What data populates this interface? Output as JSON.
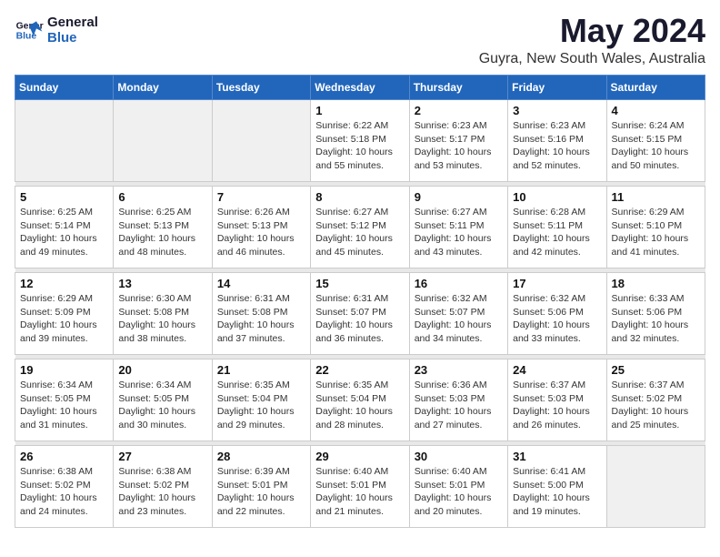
{
  "header": {
    "logo_line1": "General",
    "logo_line2": "Blue",
    "month": "May 2024",
    "location": "Guyra, New South Wales, Australia"
  },
  "weekdays": [
    "Sunday",
    "Monday",
    "Tuesday",
    "Wednesday",
    "Thursday",
    "Friday",
    "Saturday"
  ],
  "weeks": [
    [
      {
        "day": "",
        "empty": true
      },
      {
        "day": "",
        "empty": true
      },
      {
        "day": "",
        "empty": true
      },
      {
        "day": "1",
        "sunrise": "6:22 AM",
        "sunset": "5:18 PM",
        "daylight": "10 hours and 55 minutes."
      },
      {
        "day": "2",
        "sunrise": "6:23 AM",
        "sunset": "5:17 PM",
        "daylight": "10 hours and 53 minutes."
      },
      {
        "day": "3",
        "sunrise": "6:23 AM",
        "sunset": "5:16 PM",
        "daylight": "10 hours and 52 minutes."
      },
      {
        "day": "4",
        "sunrise": "6:24 AM",
        "sunset": "5:15 PM",
        "daylight": "10 hours and 50 minutes."
      }
    ],
    [
      {
        "day": "5",
        "sunrise": "6:25 AM",
        "sunset": "5:14 PM",
        "daylight": "10 hours and 49 minutes."
      },
      {
        "day": "6",
        "sunrise": "6:25 AM",
        "sunset": "5:13 PM",
        "daylight": "10 hours and 48 minutes."
      },
      {
        "day": "7",
        "sunrise": "6:26 AM",
        "sunset": "5:13 PM",
        "daylight": "10 hours and 46 minutes."
      },
      {
        "day": "8",
        "sunrise": "6:27 AM",
        "sunset": "5:12 PM",
        "daylight": "10 hours and 45 minutes."
      },
      {
        "day": "9",
        "sunrise": "6:27 AM",
        "sunset": "5:11 PM",
        "daylight": "10 hours and 43 minutes."
      },
      {
        "day": "10",
        "sunrise": "6:28 AM",
        "sunset": "5:11 PM",
        "daylight": "10 hours and 42 minutes."
      },
      {
        "day": "11",
        "sunrise": "6:29 AM",
        "sunset": "5:10 PM",
        "daylight": "10 hours and 41 minutes."
      }
    ],
    [
      {
        "day": "12",
        "sunrise": "6:29 AM",
        "sunset": "5:09 PM",
        "daylight": "10 hours and 39 minutes."
      },
      {
        "day": "13",
        "sunrise": "6:30 AM",
        "sunset": "5:08 PM",
        "daylight": "10 hours and 38 minutes."
      },
      {
        "day": "14",
        "sunrise": "6:31 AM",
        "sunset": "5:08 PM",
        "daylight": "10 hours and 37 minutes."
      },
      {
        "day": "15",
        "sunrise": "6:31 AM",
        "sunset": "5:07 PM",
        "daylight": "10 hours and 36 minutes."
      },
      {
        "day": "16",
        "sunrise": "6:32 AM",
        "sunset": "5:07 PM",
        "daylight": "10 hours and 34 minutes."
      },
      {
        "day": "17",
        "sunrise": "6:32 AM",
        "sunset": "5:06 PM",
        "daylight": "10 hours and 33 minutes."
      },
      {
        "day": "18",
        "sunrise": "6:33 AM",
        "sunset": "5:06 PM",
        "daylight": "10 hours and 32 minutes."
      }
    ],
    [
      {
        "day": "19",
        "sunrise": "6:34 AM",
        "sunset": "5:05 PM",
        "daylight": "10 hours and 31 minutes."
      },
      {
        "day": "20",
        "sunrise": "6:34 AM",
        "sunset": "5:05 PM",
        "daylight": "10 hours and 30 minutes."
      },
      {
        "day": "21",
        "sunrise": "6:35 AM",
        "sunset": "5:04 PM",
        "daylight": "10 hours and 29 minutes."
      },
      {
        "day": "22",
        "sunrise": "6:35 AM",
        "sunset": "5:04 PM",
        "daylight": "10 hours and 28 minutes."
      },
      {
        "day": "23",
        "sunrise": "6:36 AM",
        "sunset": "5:03 PM",
        "daylight": "10 hours and 27 minutes."
      },
      {
        "day": "24",
        "sunrise": "6:37 AM",
        "sunset": "5:03 PM",
        "daylight": "10 hours and 26 minutes."
      },
      {
        "day": "25",
        "sunrise": "6:37 AM",
        "sunset": "5:02 PM",
        "daylight": "10 hours and 25 minutes."
      }
    ],
    [
      {
        "day": "26",
        "sunrise": "6:38 AM",
        "sunset": "5:02 PM",
        "daylight": "10 hours and 24 minutes."
      },
      {
        "day": "27",
        "sunrise": "6:38 AM",
        "sunset": "5:02 PM",
        "daylight": "10 hours and 23 minutes."
      },
      {
        "day": "28",
        "sunrise": "6:39 AM",
        "sunset": "5:01 PM",
        "daylight": "10 hours and 22 minutes."
      },
      {
        "day": "29",
        "sunrise": "6:40 AM",
        "sunset": "5:01 PM",
        "daylight": "10 hours and 21 minutes."
      },
      {
        "day": "30",
        "sunrise": "6:40 AM",
        "sunset": "5:01 PM",
        "daylight": "10 hours and 20 minutes."
      },
      {
        "day": "31",
        "sunrise": "6:41 AM",
        "sunset": "5:00 PM",
        "daylight": "10 hours and 19 minutes."
      },
      {
        "day": "",
        "empty": true
      }
    ]
  ]
}
